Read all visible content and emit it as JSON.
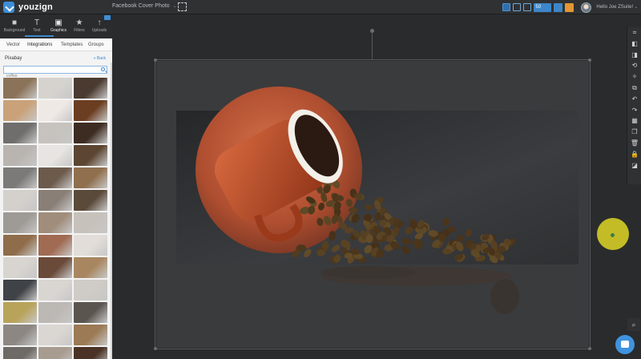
{
  "app": {
    "logo_text": "youzign",
    "document_title": "Facebook Cover Photo",
    "user_greeting": "Hello Joe ZSuite!"
  },
  "toolbar_right": {
    "zoom_select": "50"
  },
  "tools": [
    {
      "label": "Background",
      "icon": "background-icon"
    },
    {
      "label": "Text",
      "icon": "text-icon"
    },
    {
      "label": "Graphics",
      "icon": "graphics-icon"
    },
    {
      "label": "Filters",
      "icon": "filters-icon"
    },
    {
      "label": "Uploads",
      "icon": "uploads-icon"
    }
  ],
  "tabs": [
    {
      "label": "Vector"
    },
    {
      "label": "Integrations"
    },
    {
      "label": "Templates"
    },
    {
      "label": "Groups"
    }
  ],
  "panel": {
    "heading": "Pixabay",
    "back_label": "« Back",
    "search_value": "coffee",
    "thumbnail_colors": [
      "#8b7359",
      "#d6d3cf",
      "#4a3a2f",
      "#caa27a",
      "#efe9e5",
      "#6b3d21",
      "#6f6e6c",
      "#c6c2bd",
      "#3d2c22",
      "#b9b4b0",
      "#e7e4e1",
      "#5c4632",
      "#7c7a78",
      "#6c5a4b",
      "#8f6f4e",
      "#d4d0cc",
      "#8a7f76",
      "#5a4a3a",
      "#9e9a96",
      "#a08d7b",
      "#c7c1bb",
      "#8f6c4a",
      "#a06b52",
      "#e2ddd8",
      "#d8d4d0",
      "#6a4a38",
      "#a88760",
      "#3f4246",
      "#d9d6d2",
      "#cfcbc6",
      "#b8a35a",
      "#bcb8b4",
      "#5b5550",
      "#8c8782",
      "#dad6d2",
      "#9b7a55",
      "#6e6a66",
      "#a89c90",
      "#4a3326"
    ]
  },
  "right_tools": [
    "crop-icon",
    "eraser-icon",
    "flip-icon",
    "rotate-icon",
    "magic-icon",
    "duplicate-icon",
    "undo-icon",
    "redo-icon",
    "grid-icon",
    "copy-icon",
    "trash-icon",
    "lock-icon",
    "layers-icon"
  ],
  "right_tool_glyphs": [
    "⌗",
    "◧",
    "◨",
    "⟲",
    "✧",
    "⧉",
    "↶",
    "↷",
    "▦",
    "❐",
    "🗑",
    "🔒",
    "◪"
  ],
  "colors": {
    "accent": "#3d86c9",
    "cup": "#b5492a",
    "cursor_highlight": "#ded626"
  }
}
